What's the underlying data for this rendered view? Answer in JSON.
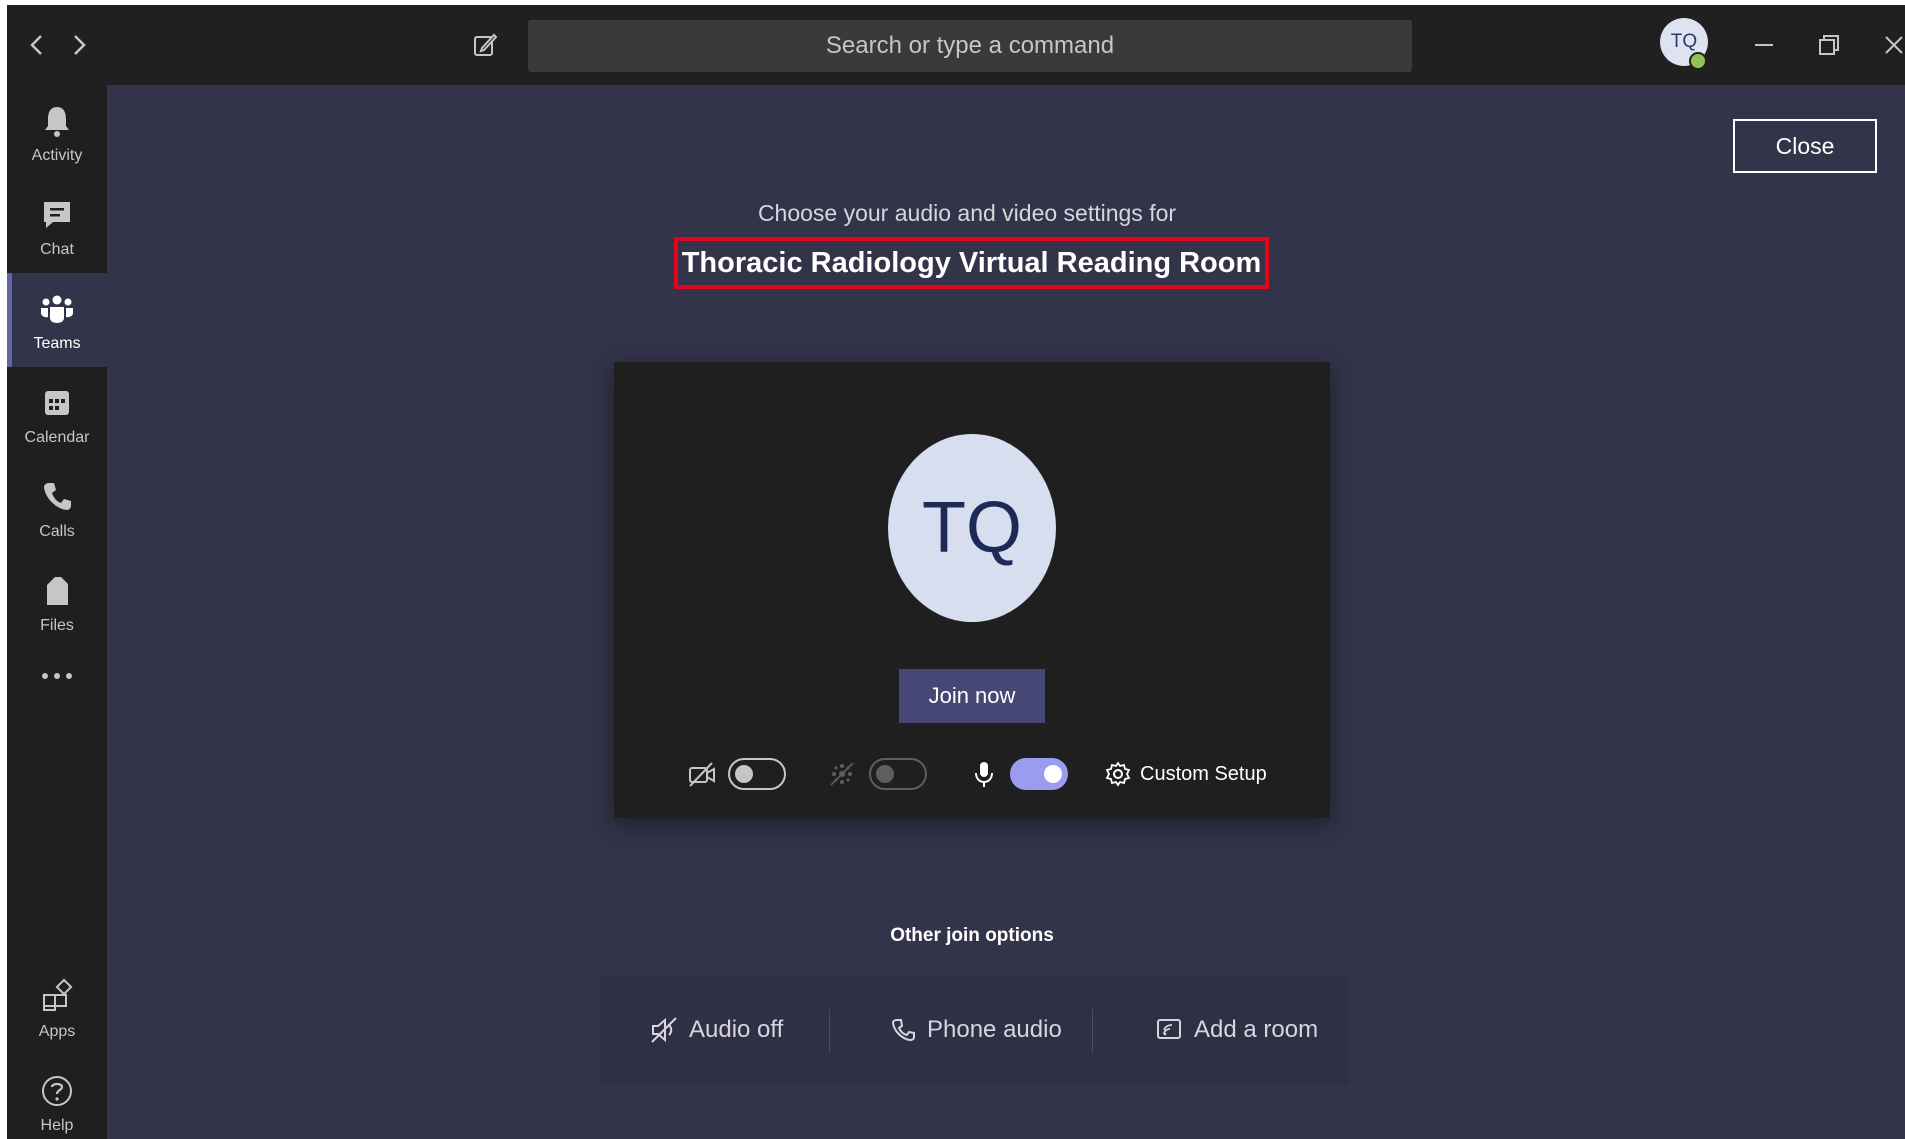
{
  "titlebar": {
    "search_placeholder": "Search or type a command",
    "user_initials": "TQ"
  },
  "rail": {
    "items": [
      {
        "label": "Activity",
        "icon": "bell-icon"
      },
      {
        "label": "Chat",
        "icon": "chat-icon"
      },
      {
        "label": "Teams",
        "icon": "teams-icon",
        "active": true
      },
      {
        "label": "Calendar",
        "icon": "calendar-icon"
      },
      {
        "label": "Calls",
        "icon": "phone-icon"
      },
      {
        "label": "Files",
        "icon": "file-icon"
      },
      {
        "label": "Apps",
        "icon": "apps-icon"
      },
      {
        "label": "Help",
        "icon": "help-icon"
      }
    ]
  },
  "main": {
    "close_label": "Close",
    "subtitle": "Choose your audio and video settings for",
    "meeting_title": "Thoracic Radiology Virtual Reading Room",
    "preview": {
      "initials": "TQ",
      "join_label": "Join now",
      "video_on": false,
      "blur_on": false,
      "mic_on": true,
      "custom_setup_label": "Custom Setup"
    },
    "other_options_label": "Other join options",
    "other_options": [
      {
        "label": "Audio off",
        "icon": "speaker-off-icon"
      },
      {
        "label": "Phone audio",
        "icon": "phone-icon"
      },
      {
        "label": "Add a room",
        "icon": "cast-room-icon"
      }
    ]
  },
  "colors": {
    "accent": "#6264a7",
    "highlight_border": "#e1061c",
    "background": "#33344a"
  }
}
